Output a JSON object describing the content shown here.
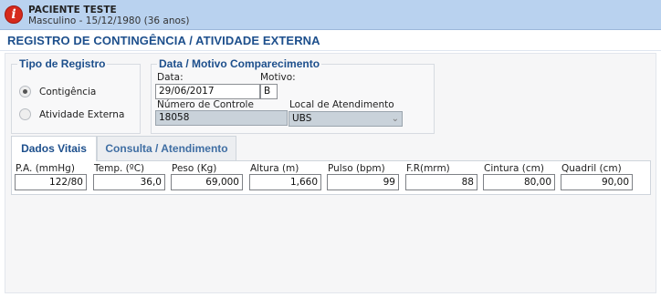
{
  "patient": {
    "name": "PACIENTE TESTE",
    "info": "Masculino - 15/12/1980 (36 anos)",
    "alert_icon_glyph": "i"
  },
  "page_title": "REGISTRO DE CONTINGÊNCIA / ATIVIDADE EXTERNA",
  "registro": {
    "legend": "Tipo de Registro",
    "options": [
      {
        "label": "Contigência",
        "checked": true
      },
      {
        "label": "Atividade Externa",
        "checked": false
      }
    ]
  },
  "comparecimento": {
    "legend": "Data / Motivo Comparecimento",
    "data_label": "Data:",
    "data_value": "29/06/2017",
    "motivo_label": "Motivo:",
    "motivo_value": "B",
    "controle_label": "Número de Controle",
    "controle_value": "18058",
    "local_label": "Local de Atendimento",
    "local_value": "UBS"
  },
  "tabs": [
    {
      "label": "Dados Vitais",
      "active": true
    },
    {
      "label": "Consulta / Atendimento",
      "active": false
    }
  ],
  "vitals": [
    {
      "label": "P.A. (mmHg)",
      "value": "122/80"
    },
    {
      "label": "Temp. (ºC)",
      "value": "36,0"
    },
    {
      "label": "Peso (Kg)",
      "value": "69,000"
    },
    {
      "label": "Altura (m)",
      "value": "1,660"
    },
    {
      "label": "Pulso (bpm)",
      "value": "99"
    },
    {
      "label": "F.R(mrm)",
      "value": "88"
    },
    {
      "label": "Cintura (cm)",
      "value": "80,00"
    },
    {
      "label": "Quadril (cm)",
      "value": "90,00"
    }
  ]
}
